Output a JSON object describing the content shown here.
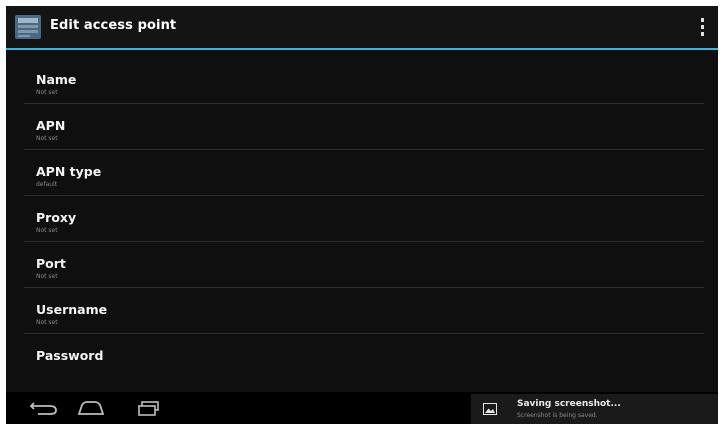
{
  "action_bar": {
    "title": "Edit access point",
    "app_icon": "settings-app-icon",
    "overflow_icon": "overflow-menu-icon",
    "accent_color": "#33b5e5"
  },
  "preferences": [
    {
      "title": "Name",
      "summary": "Not set"
    },
    {
      "title": "APN",
      "summary": "Not set"
    },
    {
      "title": "APN type",
      "summary": "default"
    },
    {
      "title": "Proxy",
      "summary": "Not set"
    },
    {
      "title": "Port",
      "summary": "Not set"
    },
    {
      "title": "Username",
      "summary": "Not set"
    },
    {
      "title": "Password",
      "summary": ""
    }
  ],
  "nav_bar": {
    "back_icon": "back-icon",
    "home_icon": "home-icon",
    "recents_icon": "recents-icon"
  },
  "notification": {
    "icon": "image-icon",
    "title": "Saving screenshot...",
    "text": "Screenshot is being saved."
  }
}
